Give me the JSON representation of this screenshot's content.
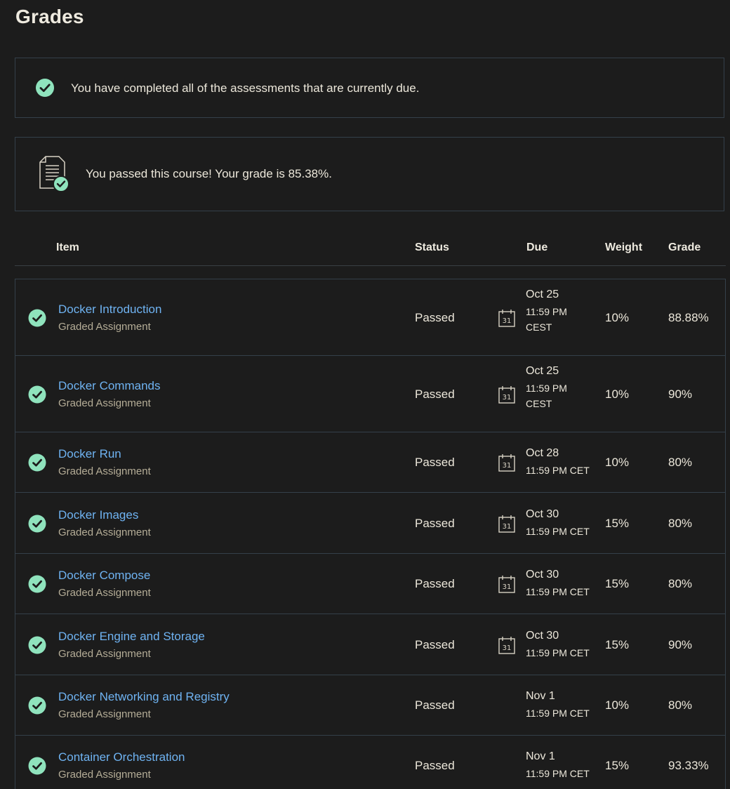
{
  "page": {
    "title": "Grades"
  },
  "notices": {
    "assessments": "You have completed all of the assessments that are currently due.",
    "course": "You passed this course! Your grade is 85.38%."
  },
  "table": {
    "headers": {
      "item": "Item",
      "status": "Status",
      "due": "Due",
      "weight": "Weight",
      "grade": "Grade"
    },
    "rows": [
      {
        "title": "Docker Introduction",
        "type": "Graded Assignment",
        "status": "Passed",
        "due_date": "Oct 25",
        "due_time": "11:59 PM",
        "due_tz": "CEST",
        "calendar_day": "31",
        "weight": "10%",
        "grade": "88.88%"
      },
      {
        "title": "Docker Commands",
        "type": "Graded Assignment",
        "status": "Passed",
        "due_date": "Oct 25",
        "due_time": "11:59 PM",
        "due_tz": "CEST",
        "calendar_day": "31",
        "weight": "10%",
        "grade": "90%"
      },
      {
        "title": "Docker Run",
        "type": "Graded Assignment",
        "status": "Passed",
        "due_date": "Oct 28",
        "due_time": "11:59 PM CET",
        "due_tz": "",
        "calendar_day": "31",
        "weight": "10%",
        "grade": "80%"
      },
      {
        "title": "Docker Images",
        "type": "Graded Assignment",
        "status": "Passed",
        "due_date": "Oct 30",
        "due_time": "11:59 PM CET",
        "due_tz": "",
        "calendar_day": "31",
        "weight": "15%",
        "grade": "80%"
      },
      {
        "title": "Docker Compose",
        "type": "Graded Assignment",
        "status": "Passed",
        "due_date": "Oct 30",
        "due_time": "11:59 PM CET",
        "due_tz": "",
        "calendar_day": "31",
        "weight": "15%",
        "grade": "80%"
      },
      {
        "title": "Docker Engine and Storage",
        "type": "Graded Assignment",
        "status": "Passed",
        "due_date": "Oct 30",
        "due_time": "11:59 PM CET",
        "due_tz": "",
        "calendar_day": "31",
        "weight": "15%",
        "grade": "90%"
      },
      {
        "title": "Docker Networking and Registry",
        "type": "Graded Assignment",
        "status": "Passed",
        "due_date": "Nov 1",
        "due_time": "11:59 PM CET",
        "due_tz": "",
        "calendar_day": "",
        "weight": "10%",
        "grade": "80%"
      },
      {
        "title": "Container Orchestration",
        "type": "Graded Assignment",
        "status": "Passed",
        "due_date": "Nov 1",
        "due_time": "11:59 PM CET",
        "due_tz": "",
        "calendar_day": "",
        "weight": "15%",
        "grade": "93.33%"
      }
    ]
  },
  "colors": {
    "background": "#1c1c1c",
    "link": "#6fb3f2",
    "success": "#8fe3bd",
    "border": "#34404a",
    "subtext": "#b5ad97"
  },
  "icons": {
    "completed": "check-circle-icon",
    "course": "document-check-icon",
    "due": "calendar-icon"
  }
}
